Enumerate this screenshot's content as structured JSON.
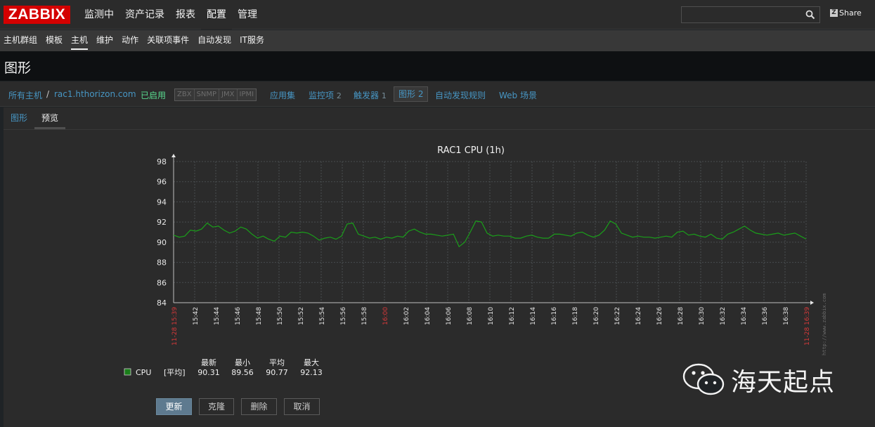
{
  "header": {
    "logo": "ZABBIX",
    "menu": [
      "监测中",
      "资产记录",
      "报表",
      "配置",
      "管理"
    ],
    "search_placeholder": "",
    "share_label": "Share"
  },
  "submenu": [
    "主机群组",
    "模板",
    "主机",
    "维护",
    "动作",
    "关联项事件",
    "自动发现",
    "IT服务"
  ],
  "page_title": "图形",
  "hostnav": {
    "all_hosts": "所有主机",
    "separator": "/",
    "host": "rac1.hthorizon.com",
    "status": "已启用",
    "badges": [
      "ZBX",
      "SNMP",
      "JMX",
      "IPMI"
    ],
    "applications": "应用集",
    "items": "监控项",
    "items_count": "2",
    "triggers": "触发器",
    "triggers_count": "1",
    "graphs": "图形",
    "graphs_count": "2",
    "discovery": "自动发现规则",
    "web": "Web 场景"
  },
  "tabs": [
    "图形",
    "预览"
  ],
  "chart_data": {
    "type": "line",
    "title": "RAC1 CPU (1h)",
    "ylim": [
      84,
      98
    ],
    "yticks": [
      "84",
      "86",
      "88",
      "90",
      "92",
      "94",
      "96",
      "98"
    ],
    "xtick_labels": [
      "11-28 15:39",
      "15:42",
      "15:44",
      "15:46",
      "15:48",
      "15:50",
      "15:52",
      "15:54",
      "15:56",
      "15:58",
      "16:00",
      "16:02",
      "16:04",
      "16:06",
      "16:08",
      "16:10",
      "16:12",
      "16:14",
      "16:16",
      "16:18",
      "16:20",
      "16:22",
      "16:24",
      "16:26",
      "16:28",
      "16:30",
      "16:32",
      "16:34",
      "16:36",
      "16:38",
      "11-28 16:39"
    ],
    "red_ticks": [
      "11-28 15:39",
      "16:00",
      "11-28 16:39"
    ],
    "side_text": "http://www.zabbix.com",
    "series": [
      {
        "name": "CPU",
        "color": "#1a9e1a",
        "values": [
          90.7,
          90.5,
          90.6,
          91.2,
          91.1,
          91.3,
          91.9,
          91.5,
          91.6,
          91.2,
          90.9,
          91.1,
          91.5,
          91.3,
          90.8,
          90.4,
          90.6,
          90.3,
          90.1,
          90.6,
          90.5,
          91.0,
          90.9,
          91.0,
          90.9,
          90.6,
          90.2,
          90.4,
          90.5,
          90.3,
          90.6,
          91.8,
          91.9,
          90.8,
          90.6,
          90.4,
          90.5,
          90.3,
          90.5,
          90.4,
          90.6,
          90.5,
          91.1,
          91.3,
          91.0,
          90.8,
          90.8,
          90.7,
          90.6,
          90.7,
          90.8,
          89.56,
          90.0,
          91.0,
          92.1,
          92.0,
          90.9,
          90.6,
          90.7,
          90.6,
          90.6,
          90.4,
          90.4,
          90.6,
          90.7,
          90.5,
          90.4,
          90.4,
          90.8,
          90.8,
          90.7,
          90.6,
          90.9,
          91.0,
          90.7,
          90.5,
          90.7,
          91.2,
          92.1,
          91.8,
          90.9,
          90.7,
          90.5,
          90.6,
          90.5,
          90.5,
          90.4,
          90.5,
          90.6,
          90.5,
          91.0,
          91.1,
          90.7,
          90.8,
          90.6,
          90.5,
          90.8,
          90.4,
          90.3,
          90.8,
          91.0,
          91.3,
          91.6,
          91.2,
          90.9,
          90.8,
          90.7,
          90.8,
          90.9,
          90.7,
          90.8,
          90.9,
          90.6,
          90.31
        ]
      }
    ]
  },
  "legend": {
    "name": "CPU",
    "func": "[平均]",
    "headers": [
      "最新",
      "最小",
      "平均",
      "最大"
    ],
    "values": [
      "90.31",
      "89.56",
      "90.77",
      "92.13"
    ],
    "color": "#1a7e1a"
  },
  "buttons": [
    "更新",
    "克隆",
    "删除",
    "取消"
  ],
  "watermark": "海天起点"
}
